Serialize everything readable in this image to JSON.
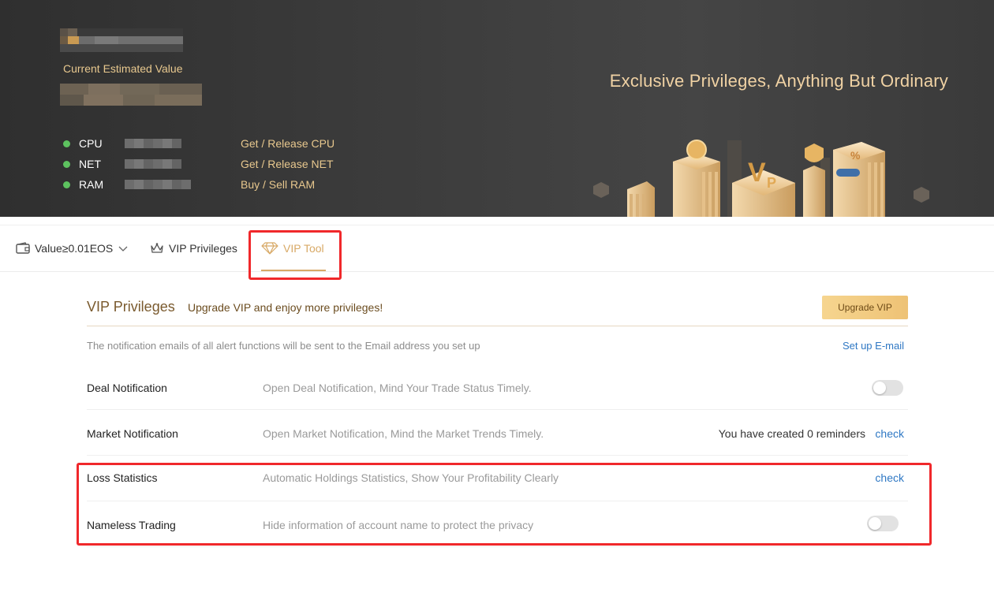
{
  "hero": {
    "estimated_label": "Current Estimated Value",
    "tagline": "Exclusive Privileges, Anything But Ordinary",
    "resources": [
      {
        "name": "CPU",
        "action": "Get / Release CPU"
      },
      {
        "name": "NET",
        "action": "Get / Release NET"
      },
      {
        "name": "RAM",
        "action": "Buy / Sell RAM"
      }
    ]
  },
  "tabs": {
    "value_filter": "Value≥0.01EOS",
    "vip_privileges": "VIP Privileges",
    "vip_tool": "VIP Tool"
  },
  "section": {
    "title": "VIP Privileges",
    "subtitle": "Upgrade VIP and enjoy more privileges!",
    "upgrade_button": "Upgrade VIP",
    "notice": "The notification emails of all alert functions will be sent to the Email address you set up",
    "setup_email_link": "Set up E-mail"
  },
  "features": [
    {
      "label": "Deal Notification",
      "desc": "Open Deal Notification, Mind Your Trade Status Timely.",
      "enabled": false
    },
    {
      "label": "Market Notification",
      "desc": "Open Market Notification, Mind the Market Trends Timely.",
      "reminder_text": "You have created 0 reminders",
      "link": "check"
    },
    {
      "label": "Loss Statistics",
      "desc": "Automatic Holdings Statistics, Show Your Profitability Clearly",
      "link": "check"
    },
    {
      "label": "Nameless Trading",
      "desc": "Hide information of account name to protect the privacy",
      "enabled": false
    }
  ],
  "colors": {
    "accent_gold": "#d8a966",
    "link_blue": "#2f78c4",
    "status_green": "#5dc25f",
    "highlight_red": "#f0282b"
  }
}
